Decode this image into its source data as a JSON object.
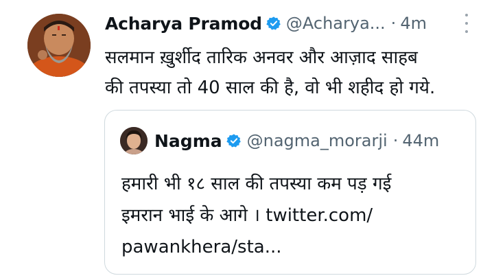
{
  "tweet": {
    "author_name": "Acharya Pramod",
    "handle": "@Acharya...",
    "separator": "·",
    "time": "4m",
    "text_lines": [
      "सलमान ख़ुर्शीद तारिक अनवर और आज़ाद साहब",
      "की तपस्या तो 40 साल की है, वो भी शहीद हो गये."
    ]
  },
  "quoted": {
    "author_name": "Nagma",
    "handle": "@nagma_morarji",
    "separator": "·",
    "time": "44m",
    "text_lines": [
      "हमारी भी १८ साल की तपस्या कम पड़ गई",
      "इमरान भाई के आगे । twitter.com/",
      "pawankhera/sta..."
    ]
  },
  "colors": {
    "verified_blue": "#1d9bf0",
    "secondary_text": "#536471",
    "border": "#cfd9de"
  },
  "icons": {
    "verified": "verified-badge-icon",
    "more": "more-options-icon"
  }
}
